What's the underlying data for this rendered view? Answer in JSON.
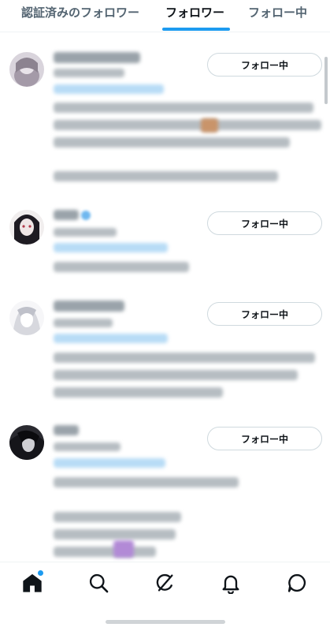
{
  "tabs": {
    "verified": "認証済みのフォロワー",
    "followers": "フォロワー",
    "following": "フォロー中"
  },
  "users": [
    {
      "button": "フォロー中"
    },
    {
      "button": "フォロー中"
    },
    {
      "button": "フォロー中"
    },
    {
      "button": "フォロー中"
    }
  ],
  "nav": {
    "icons": [
      "home-icon",
      "search-icon",
      "grok-icon",
      "notifications-icon",
      "messages-icon"
    ]
  },
  "colors": {
    "accent": "#1d9bf0",
    "text": "#0f1419",
    "muted": "#536471"
  }
}
